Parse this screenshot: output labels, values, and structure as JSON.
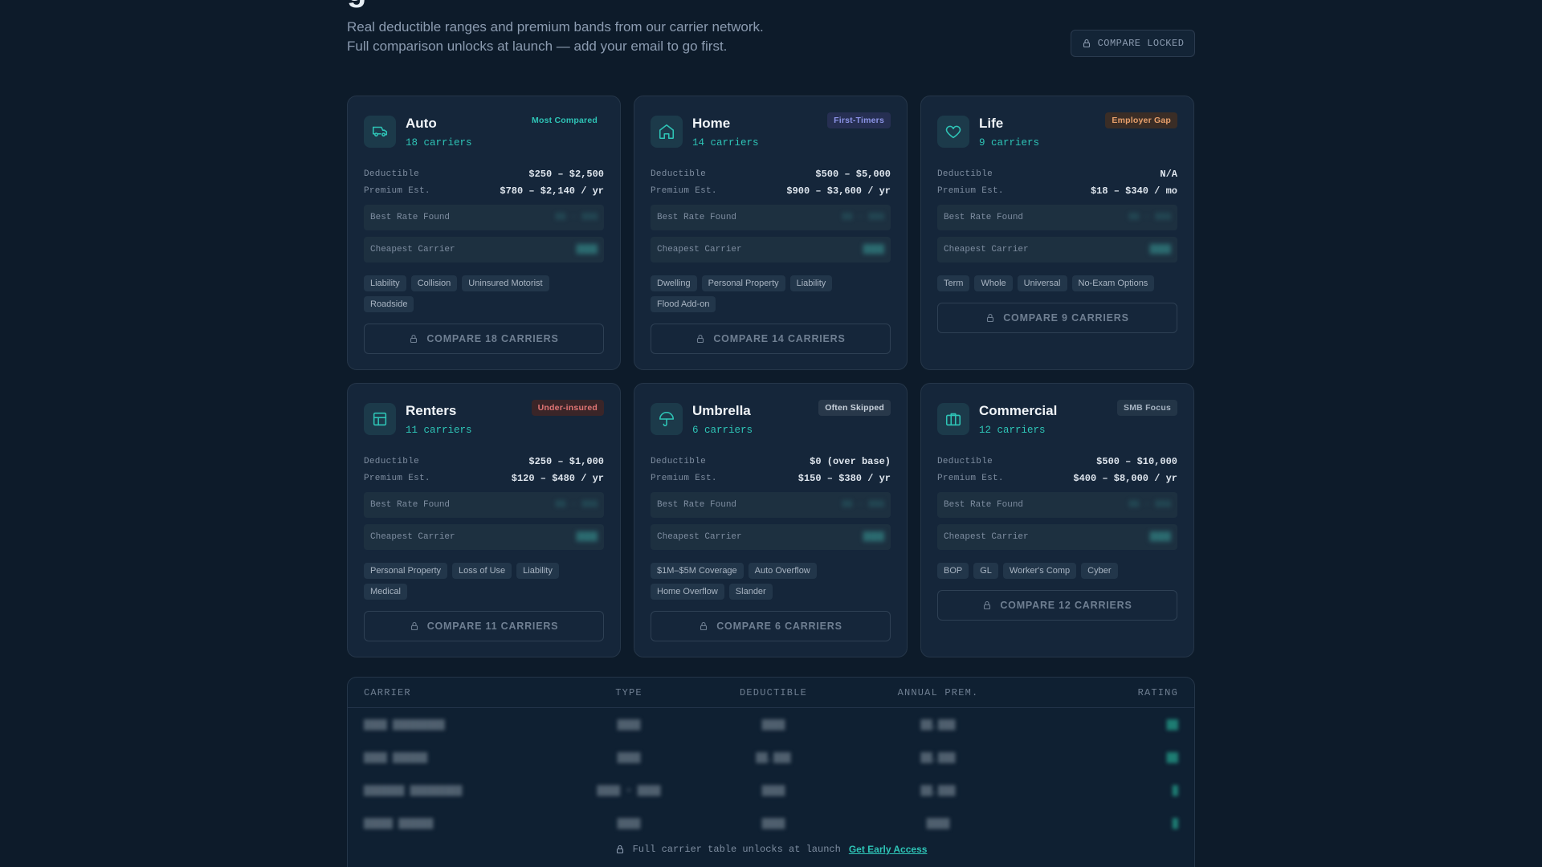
{
  "header": {
    "subtitle_line1": "Real deductible ranges and premium bands from our carrier network.",
    "subtitle_line2": "Full comparison unlocks at launch — add your email to go first.",
    "compare_locked_label": "COMPARE LOCKED"
  },
  "cards": [
    {
      "title": "Auto",
      "carriers": "18 carriers",
      "badge": "Most Compared",
      "icon": "car-icon",
      "deductible_label": "Deductible",
      "deductible": "$250 – $2,500",
      "premium_label": "Premium Est.",
      "premium": "$780 – $2,140 / yr",
      "best_rate_label": "Best Rate Found",
      "cheapest_label": "Cheapest Carrier",
      "tags": [
        "Liability",
        "Collision",
        "Uninsured Motorist",
        "Roadside"
      ],
      "button": "COMPARE 18 CARRIERS"
    },
    {
      "title": "Home",
      "carriers": "14 carriers",
      "badge": "First-Timers",
      "icon": "house-icon",
      "deductible_label": "Deductible",
      "deductible": "$500 – $5,000",
      "premium_label": "Premium Est.",
      "premium": "$900 – $3,600 / yr",
      "best_rate_label": "Best Rate Found",
      "cheapest_label": "Cheapest Carrier",
      "tags": [
        "Dwelling",
        "Personal Property",
        "Liability",
        "Flood Add-on"
      ],
      "button": "COMPARE 14 CARRIERS"
    },
    {
      "title": "Life",
      "carriers": "9 carriers",
      "badge": "Employer Gap",
      "icon": "heart-icon",
      "deductible_label": "Deductible",
      "deductible": "N/A",
      "premium_label": "Premium Est.",
      "premium": "$18 – $340 / mo",
      "best_rate_label": "Best Rate Found",
      "cheapest_label": "Cheapest Carrier",
      "tags": [
        "Term",
        "Whole",
        "Universal",
        "No-Exam Options"
      ],
      "button": "COMPARE 9 CARRIERS"
    },
    {
      "title": "Renters",
      "carriers": "11 carriers",
      "badge": "Under-insured",
      "icon": "building-icon",
      "deductible_label": "Deductible",
      "deductible": "$250 – $1,000",
      "premium_label": "Premium Est.",
      "premium": "$120 – $480 / yr",
      "best_rate_label": "Best Rate Found",
      "cheapest_label": "Cheapest Carrier",
      "tags": [
        "Personal Property",
        "Loss of Use",
        "Liability",
        "Medical"
      ],
      "button": "COMPARE 11 CARRIERS"
    },
    {
      "title": "Umbrella",
      "carriers": "6 carriers",
      "badge": "Often Skipped",
      "icon": "umbrella-icon",
      "deductible_label": "Deductible",
      "deductible": "$0 (over base)",
      "premium_label": "Premium Est.",
      "premium": "$150 – $380 / yr",
      "best_rate_label": "Best Rate Found",
      "cheapest_label": "Cheapest Carrier",
      "tags": [
        "$1M–$5M Coverage",
        "Auto Overflow",
        "Home Overflow",
        "Slander"
      ],
      "button": "COMPARE 6 CARRIERS"
    },
    {
      "title": "Commercial",
      "carriers": "12 carriers",
      "badge": "SMB Focus",
      "icon": "briefcase-icon",
      "deductible_label": "Deductible",
      "deductible": "$500 – $10,000",
      "premium_label": "Premium Est.",
      "premium": "$400 – $8,000 / yr",
      "best_rate_label": "Best Rate Found",
      "cheapest_label": "Cheapest Carrier",
      "tags": [
        "BOP",
        "GL",
        "Worker's Comp",
        "Cyber"
      ],
      "button": "COMPARE 12 CARRIERS"
    }
  ],
  "table": {
    "headers": {
      "carrier": "CARRIER",
      "type": "TYPE",
      "deductible": "DEDUCTIBLE",
      "premium": "ANNUAL PREM.",
      "rating": "RATING"
    },
    "footer_text": "Full carrier table unlocks at launch",
    "early_access_label": "Get Early Access"
  },
  "colors": {
    "background": "#0d1b2a",
    "card": "#15263a",
    "accent": "#2ec4b6"
  }
}
